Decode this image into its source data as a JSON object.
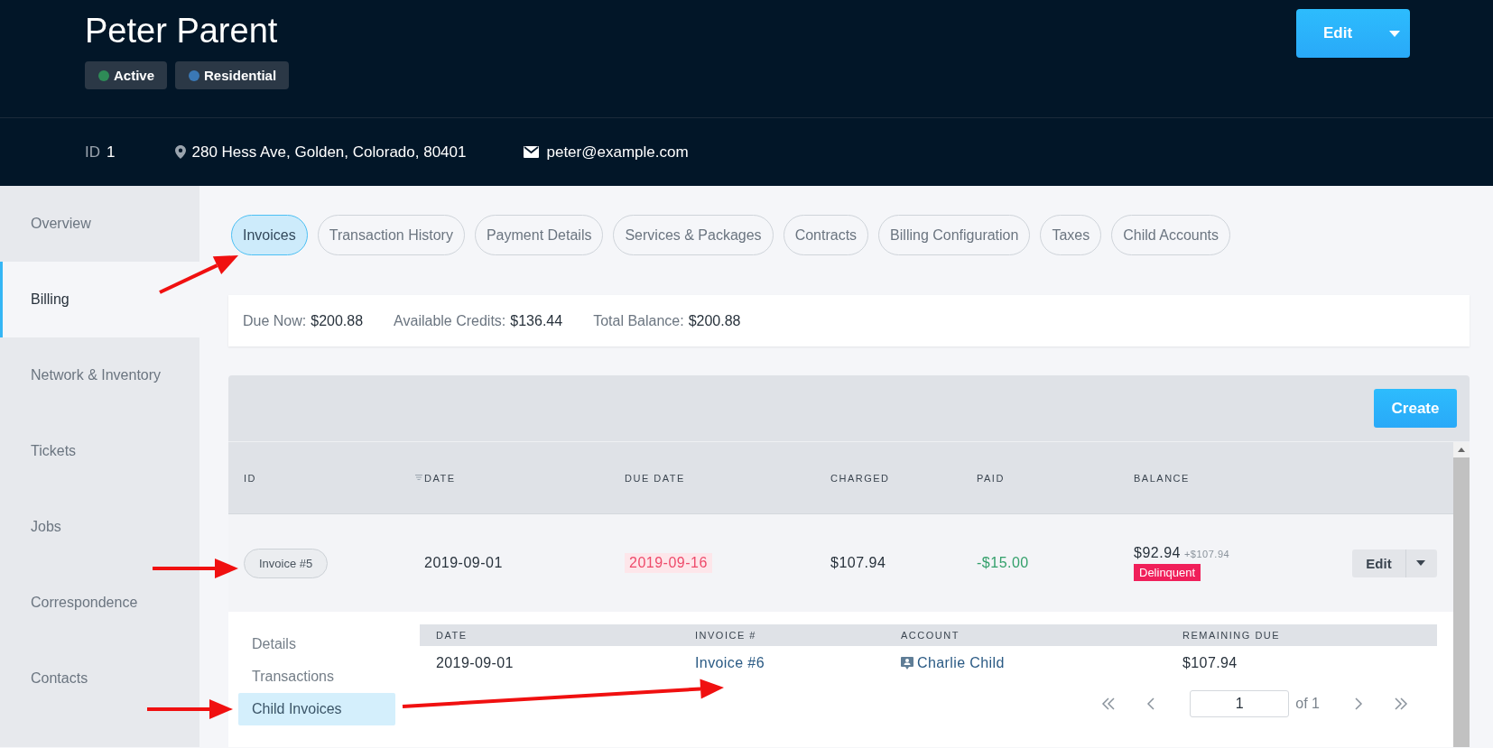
{
  "header": {
    "name": "Peter Parent",
    "badges": [
      {
        "label": "Active",
        "color": "#2e8b57"
      },
      {
        "label": "Residential",
        "color": "#3a78b5"
      }
    ],
    "edit_button": "Edit",
    "id_label": "ID",
    "id_value": "1",
    "address": "280 Hess Ave, Golden, Colorado, 80401",
    "email": "peter@example.com"
  },
  "sidebar": {
    "items": [
      {
        "label": "Overview",
        "selected": false
      },
      {
        "label": "Billing",
        "selected": true
      },
      {
        "label": "Network & Inventory",
        "selected": false
      },
      {
        "label": "Tickets",
        "selected": false
      },
      {
        "label": "Jobs",
        "selected": false
      },
      {
        "label": "Correspondence",
        "selected": false
      },
      {
        "label": "Contacts",
        "selected": false
      }
    ]
  },
  "tabs": [
    {
      "label": "Invoices",
      "selected": true
    },
    {
      "label": "Transaction History",
      "selected": false
    },
    {
      "label": "Payment Details",
      "selected": false
    },
    {
      "label": "Services & Packages",
      "selected": false
    },
    {
      "label": "Contracts",
      "selected": false
    },
    {
      "label": "Billing Configuration",
      "selected": false
    },
    {
      "label": "Taxes",
      "selected": false
    },
    {
      "label": "Child Accounts",
      "selected": false
    }
  ],
  "summary": [
    {
      "label": "Due Now:",
      "value": "$200.88"
    },
    {
      "label": "Available Credits:",
      "value": "$136.44"
    },
    {
      "label": "Total Balance:",
      "value": "$200.88"
    }
  ],
  "invoices": {
    "create_button": "Create",
    "columns": [
      {
        "label": "ID",
        "sorted": false
      },
      {
        "label": "DATE",
        "sorted": true
      },
      {
        "label": "DUE DATE",
        "sorted": false
      },
      {
        "label": "CHARGED",
        "sorted": false
      },
      {
        "label": "PAID",
        "sorted": false
      },
      {
        "label": "BALANCE",
        "sorted": false
      }
    ],
    "rows": [
      {
        "id": "Invoice #5",
        "date": "2019-09-01",
        "due_date": "2019-09-16",
        "overdue": true,
        "charged": "$107.94",
        "paid": "-$15.00",
        "balance": "$92.94",
        "balance_note": "+$107.94",
        "status": "Delinquent",
        "edit_button": "Edit",
        "expanded": true,
        "detail": {
          "menu": [
            {
              "label": "Details",
              "selected": false
            },
            {
              "label": "Transactions",
              "selected": false
            },
            {
              "label": "Child Invoices",
              "selected": true
            }
          ],
          "columns": [
            "DATE",
            "INVOICE #",
            "ACCOUNT",
            "REMAINING DUE"
          ],
          "rows": [
            {
              "date": "2019-09-01",
              "invoice": "Invoice #6",
              "account": "Charlie Child",
              "remaining_due": "$107.94"
            }
          ],
          "pagination": {
            "page": "1",
            "of_pages": "of 1"
          }
        }
      }
    ]
  }
}
